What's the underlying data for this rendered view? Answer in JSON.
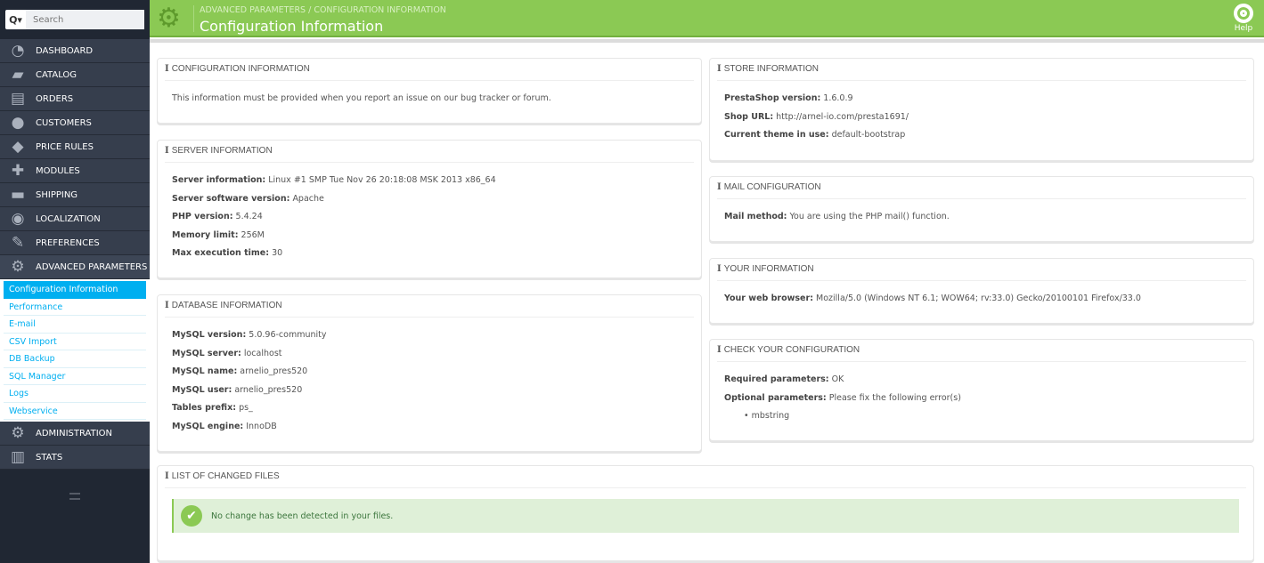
{
  "search": {
    "placeholder": "Search",
    "button": "Q▾"
  },
  "menu": [
    {
      "label": "DASHBOARD",
      "icon": "dashboard-icon",
      "glyph": "◔"
    },
    {
      "label": "CATALOG",
      "icon": "book-icon",
      "glyph": "▰"
    },
    {
      "label": "ORDERS",
      "icon": "credit-card-icon",
      "glyph": "▤"
    },
    {
      "label": "CUSTOMERS",
      "icon": "users-icon",
      "glyph": "●"
    },
    {
      "label": "PRICE RULES",
      "icon": "tags-icon",
      "glyph": "◆"
    },
    {
      "label": "MODULES",
      "icon": "puzzle-icon",
      "glyph": "✚"
    },
    {
      "label": "SHIPPING",
      "icon": "truck-icon",
      "glyph": "▬"
    },
    {
      "label": "LOCALIZATION",
      "icon": "globe-icon",
      "glyph": "◉"
    },
    {
      "label": "PREFERENCES",
      "icon": "wrench-icon",
      "glyph": "✎"
    },
    {
      "label": "ADVANCED PARAMETERS",
      "icon": "cogs-icon",
      "glyph": "⚙",
      "active": true
    }
  ],
  "submenu": [
    "Configuration Information",
    "Performance",
    "E-mail",
    "CSV Import",
    "DB Backup",
    "SQL Manager",
    "Logs",
    "Webservice"
  ],
  "menu_after": [
    {
      "label": "ADMINISTRATION",
      "icon": "gear-icon",
      "glyph": "⚙"
    },
    {
      "label": "STATS",
      "icon": "bar-chart-icon",
      "glyph": "▥"
    }
  ],
  "header": {
    "breadcrumb": "ADVANCED PARAMETERS  /  CONFIGURATION INFORMATION",
    "title": "Configuration Information",
    "help": "Help"
  },
  "panels": [
    {
      "id": "configuration",
      "title": "CONFIGURATION INFORMATION",
      "text": "This information must be provided when you report an issue on our bug tracker or forum."
    },
    {
      "id": "server",
      "title": "SERVER INFORMATION",
      "rows": [
        [
          "Server information:",
          "Linux #1 SMP Tue Nov 26 20:18:08 MSK 2013 x86_64"
        ],
        [
          "Server software version:",
          "Apache"
        ],
        [
          "PHP version:",
          "5.4.24"
        ],
        [
          "Memory limit:",
          "256M"
        ],
        [
          "Max execution time:",
          "30"
        ]
      ]
    },
    {
      "id": "database",
      "title": "DATABASE INFORMATION",
      "rows": [
        [
          "MySQL version:",
          "5.0.96-community"
        ],
        [
          "MySQL server:",
          "localhost"
        ],
        [
          "MySQL name:",
          "arnelio_pres520"
        ],
        [
          "MySQL user:",
          "arnelio_pres520"
        ],
        [
          "Tables prefix:",
          "ps_"
        ],
        [
          "MySQL engine:",
          "InnoDB"
        ]
      ]
    },
    {
      "id": "store",
      "title": "STORE INFORMATION",
      "rows": [
        [
          "PrestaShop version:",
          "1.6.0.9"
        ],
        [
          "Shop URL:",
          "http://arnel-io.com/presta1691/"
        ],
        [
          "Current theme in use:",
          "default-bootstrap"
        ]
      ]
    },
    {
      "id": "mail",
      "title": "MAIL CONFIGURATION",
      "rows": [
        [
          "Mail method:",
          "You are using the PHP mail() function."
        ]
      ]
    },
    {
      "id": "your",
      "title": "YOUR INFORMATION",
      "rows": [
        [
          "Your web browser:",
          "Mozilla/5.0 (Windows NT 6.1; WOW64; rv:33.0) Gecko/20100101 Firefox/33.0"
        ]
      ]
    },
    {
      "id": "check",
      "title": "CHECK YOUR CONFIGURATION",
      "rows": [
        [
          "Required parameters:",
          "OK"
        ],
        [
          "Optional parameters:",
          "Please fix the following error(s)"
        ]
      ],
      "bullets": [
        "mbstring"
      ]
    },
    {
      "id": "changed",
      "title": "LIST OF CHANGED FILES",
      "alert": "No change has been detected in your files."
    }
  ]
}
